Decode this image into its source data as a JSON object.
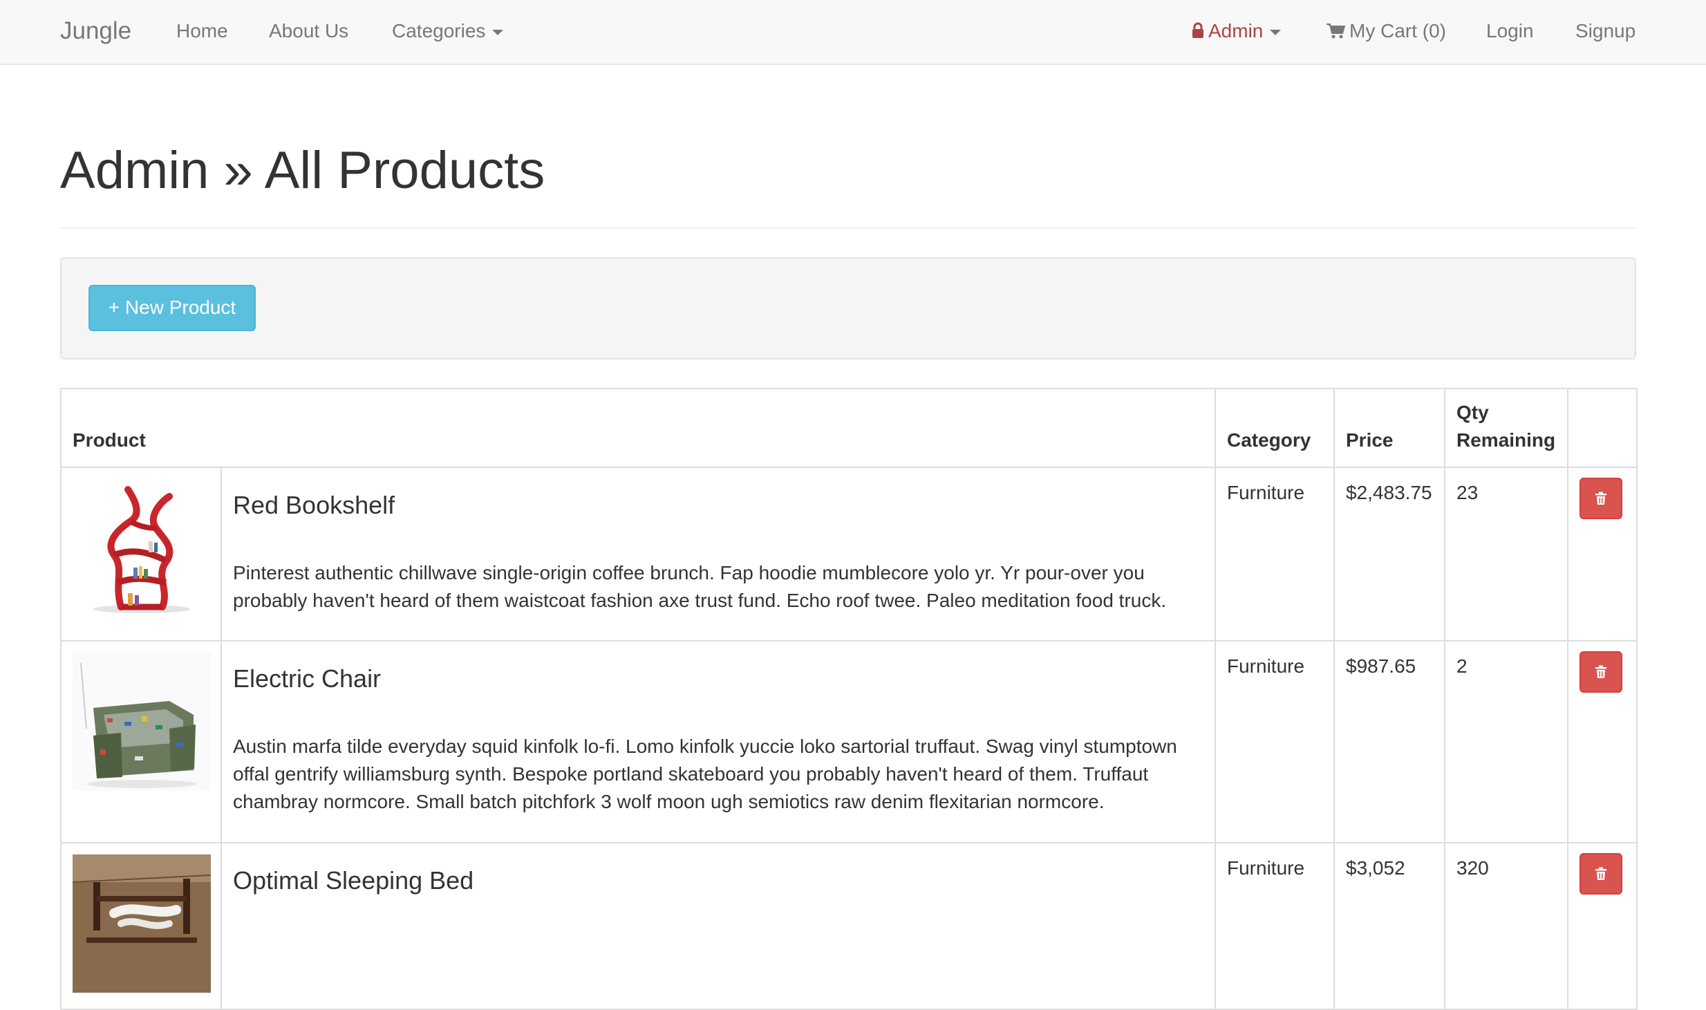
{
  "navbar": {
    "brand": "Jungle",
    "links": {
      "home": "Home",
      "about": "About Us",
      "categories": "Categories",
      "admin": "Admin",
      "cart": "My Cart (0)",
      "login": "Login",
      "signup": "Signup"
    }
  },
  "page": {
    "title": "Admin » All Products",
    "new_product_label": "+ New Product"
  },
  "table": {
    "headers": {
      "product": "Product",
      "category": "Category",
      "price": "Price",
      "qty_line1": "Qty",
      "qty_line2": "Remaining"
    },
    "rows": [
      {
        "name": "Red Bookshelf",
        "description": "Pinterest authentic chillwave single-origin coffee brunch. Fap hoodie mumblecore yolo yr. Yr pour-over you probably haven't heard of them waistcoat fashion axe trust fund. Echo roof twee. Paleo meditation food truck.",
        "category": "Furniture",
        "price": "$2,483.75",
        "qty": "23"
      },
      {
        "name": "Electric Chair",
        "description": "Austin marfa tilde everyday squid kinfolk lo-fi. Lomo kinfolk yuccie loko sartorial truffaut. Swag vinyl stumptown offal gentrify williamsburg synth. Bespoke portland skateboard you probably haven't heard of them. Truffaut chambray normcore. Small batch pitchfork 3 wolf moon ugh semiotics raw denim flexitarian normcore.",
        "category": "Furniture",
        "price": "$987.65",
        "qty": "2"
      },
      {
        "name": "Optimal Sleeping Bed",
        "description": "",
        "category": "Furniture",
        "price": "$3,052",
        "qty": "320"
      }
    ]
  },
  "colors": {
    "navbar_bg": "#f8f8f8",
    "admin_link": "#a94442",
    "info_button": "#5bc0de",
    "danger_button": "#d9534f"
  },
  "icons": [
    "lock-icon",
    "cart-icon",
    "caret-down-icon",
    "trash-icon"
  ]
}
